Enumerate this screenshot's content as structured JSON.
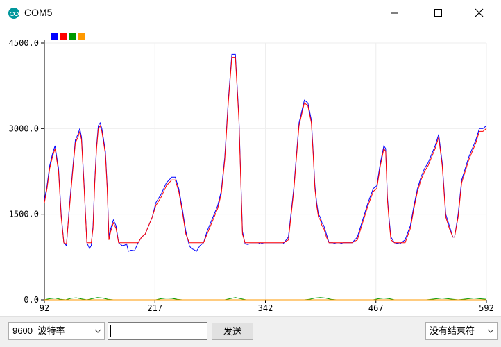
{
  "window": {
    "title": "COM5",
    "icon": "arduino-icon",
    "controls": [
      "minimize-icon",
      "maximize-icon",
      "close-icon"
    ]
  },
  "chart_data": {
    "type": "line",
    "title": "",
    "xlabel": "",
    "ylabel": "",
    "xlim": [
      92,
      592
    ],
    "ylim": [
      0,
      4500
    ],
    "x_ticks": [
      "92",
      "217",
      "342",
      "467",
      "592"
    ],
    "y_ticks": [
      "0.0",
      "1500.0",
      "3000.0",
      "4500.0"
    ],
    "grid": true,
    "legend": "top-left",
    "series": [
      {
        "color": "#0000ff",
        "x": [
          92,
          95,
          98,
          101,
          104,
          108,
          111,
          114,
          117,
          120,
          124,
          127,
          130,
          132,
          134,
          137,
          140,
          143,
          145,
          147,
          149,
          151,
          153,
          155,
          157,
          159,
          161,
          163,
          165,
          167,
          170,
          173,
          176,
          180,
          183,
          185,
          187,
          190,
          194,
          198,
          202,
          206,
          210,
          214,
          218,
          224,
          230,
          236,
          240,
          244,
          248,
          252,
          256,
          258,
          261,
          264,
          268,
          272,
          276,
          280,
          284,
          288,
          292,
          296,
          300,
          304,
          308,
          312,
          316,
          319,
          322,
          324,
          326,
          328,
          330,
          332,
          334,
          336,
          340,
          344,
          350,
          356,
          362,
          368,
          374,
          380,
          386,
          390,
          394,
          396,
          398,
          400,
          402,
          404,
          406,
          408,
          411,
          414,
          418,
          422,
          426,
          430,
          434,
          440,
          446,
          452,
          458,
          464,
          468,
          472,
          476,
          478,
          480,
          482,
          484,
          488,
          494,
          500,
          506,
          510,
          514,
          518,
          522,
          526,
          530,
          534,
          538,
          542,
          546,
          550,
          554,
          556,
          560,
          564,
          568,
          572,
          576,
          580,
          584,
          588,
          592
        ],
        "y": [
          1750,
          2000,
          2350,
          2550,
          2700,
          2300,
          1500,
          1000,
          950,
          1600,
          2300,
          2800,
          2900,
          3000,
          2850,
          2000,
          1000,
          900,
          950,
          1300,
          2100,
          2700,
          3050,
          3100,
          3000,
          2800,
          2600,
          2000,
          1100,
          1250,
          1400,
          1300,
          1000,
          950,
          960,
          980,
          850,
          870,
          860,
          1000,
          1100,
          1150,
          1300,
          1450,
          1700,
          1850,
          2050,
          2150,
          2150,
          1950,
          1600,
          1200,
          950,
          900,
          880,
          850,
          950,
          1000,
          1200,
          1350,
          1500,
          1650,
          1900,
          2500,
          3500,
          4300,
          4300,
          3200,
          1200,
          980,
          970,
          980,
          980,
          980,
          980,
          980,
          980,
          1000,
          980,
          980,
          980,
          980,
          980,
          1100,
          1950,
          3100,
          3500,
          3450,
          3150,
          2600,
          2000,
          1700,
          1500,
          1450,
          1350,
          1300,
          1150,
          1000,
          1000,
          980,
          980,
          1000,
          1000,
          1000,
          1100,
          1400,
          1700,
          1950,
          2000,
          2400,
          2700,
          2650,
          1800,
          1400,
          1100,
          1000,
          980,
          1050,
          1300,
          1650,
          1950,
          2150,
          2300,
          2400,
          2550,
          2700,
          2900,
          2400,
          1500,
          1300,
          1100,
          1100,
          1500,
          2100,
          2300,
          2500,
          2650,
          2800,
          3000,
          3000,
          3050
        ]
      },
      {
        "color": "#ff0000",
        "x": [
          92,
          95,
          98,
          101,
          104,
          108,
          111,
          114,
          117,
          120,
          124,
          127,
          130,
          132,
          134,
          137,
          140,
          143,
          145,
          147,
          149,
          151,
          153,
          155,
          157,
          159,
          161,
          163,
          165,
          167,
          170,
          173,
          176,
          180,
          183,
          185,
          187,
          190,
          194,
          198,
          202,
          206,
          210,
          214,
          218,
          224,
          230,
          236,
          240,
          244,
          248,
          252,
          256,
          258,
          261,
          264,
          268,
          272,
          276,
          280,
          284,
          288,
          292,
          296,
          300,
          304,
          308,
          312,
          316,
          319,
          322,
          324,
          326,
          328,
          330,
          332,
          334,
          336,
          340,
          344,
          350,
          356,
          362,
          368,
          374,
          380,
          386,
          390,
          394,
          396,
          398,
          400,
          402,
          404,
          406,
          408,
          411,
          414,
          418,
          422,
          426,
          430,
          434,
          440,
          446,
          452,
          458,
          464,
          468,
          472,
          476,
          478,
          480,
          482,
          484,
          488,
          494,
          500,
          506,
          510,
          514,
          518,
          522,
          526,
          530,
          534,
          538,
          542,
          546,
          550,
          554,
          556,
          560,
          564,
          568,
          572,
          576,
          580,
          584,
          588,
          592
        ],
        "y": [
          1700,
          1950,
          2300,
          2500,
          2650,
          2250,
          1450,
          1000,
          980,
          1550,
          2250,
          2750,
          2850,
          2950,
          2800,
          1950,
          1000,
          1000,
          1000,
          1250,
          2050,
          2650,
          3000,
          3050,
          2950,
          2750,
          2550,
          1950,
          1050,
          1200,
          1350,
          1250,
          1000,
          1000,
          1000,
          1000,
          1000,
          1000,
          1000,
          1000,
          1100,
          1150,
          1300,
          1450,
          1650,
          1800,
          2000,
          2100,
          2100,
          1900,
          1550,
          1150,
          1000,
          1000,
          1000,
          1000,
          1000,
          1000,
          1150,
          1300,
          1450,
          1600,
          1850,
          2450,
          3450,
          4250,
          4250,
          3150,
          1150,
          1000,
          1000,
          1000,
          1000,
          1000,
          1000,
          1000,
          1000,
          1000,
          1000,
          1000,
          1000,
          1000,
          1000,
          1050,
          1900,
          3050,
          3450,
          3400,
          3100,
          2550,
          1950,
          1650,
          1450,
          1400,
          1300,
          1250,
          1100,
          1000,
          1000,
          1000,
          1000,
          1000,
          1000,
          1000,
          1050,
          1350,
          1650,
          1900,
          1950,
          2350,
          2650,
          2600,
          1750,
          1350,
          1050,
          1000,
          1000,
          1000,
          1250,
          1600,
          1900,
          2100,
          2250,
          2350,
          2500,
          2650,
          2850,
          2350,
          1450,
          1250,
          1100,
          1100,
          1450,
          2050,
          2250,
          2450,
          2600,
          2750,
          2950,
          2950,
          3000
        ]
      },
      {
        "color": "#009900",
        "x": [
          92,
          98,
          104,
          110,
          116,
          122,
          128,
          134,
          140,
          146,
          152,
          158,
          164,
          170,
          176,
          182,
          188,
          194,
          200,
          206,
          212,
          218,
          224,
          230,
          236,
          242,
          248,
          254,
          260,
          266,
          272,
          278,
          284,
          290,
          296,
          302,
          308,
          314,
          320,
          326,
          332,
          338,
          344,
          350,
          356,
          362,
          368,
          374,
          380,
          386,
          392,
          398,
          404,
          410,
          416,
          422,
          428,
          434,
          440,
          446,
          452,
          458,
          464,
          470,
          476,
          482,
          488,
          494,
          500,
          506,
          512,
          518,
          524,
          530,
          536,
          542,
          548,
          554,
          560,
          566,
          572,
          578,
          584,
          592
        ],
        "y": [
          0,
          20,
          30,
          10,
          0,
          25,
          35,
          15,
          0,
          20,
          40,
          30,
          10,
          0,
          0,
          0,
          0,
          0,
          0,
          0,
          0,
          0,
          20,
          30,
          25,
          10,
          0,
          0,
          0,
          0,
          0,
          0,
          0,
          0,
          0,
          20,
          40,
          20,
          0,
          0,
          0,
          0,
          0,
          0,
          0,
          0,
          0,
          0,
          0,
          0,
          10,
          30,
          40,
          30,
          10,
          0,
          0,
          0,
          0,
          0,
          0,
          0,
          0,
          20,
          30,
          20,
          0,
          0,
          0,
          0,
          0,
          0,
          0,
          10,
          20,
          30,
          20,
          10,
          0,
          10,
          20,
          30,
          20,
          10
        ]
      },
      {
        "color": "#ff9900",
        "x": [
          92,
          592
        ],
        "y": [
          0,
          0
        ]
      }
    ]
  },
  "bottom_bar": {
    "baud_rate_value": "9600",
    "baud_rate_label": "波特率",
    "send_input_value": "",
    "send_button_label": "发送",
    "line_ending_value": "没有结束符"
  }
}
